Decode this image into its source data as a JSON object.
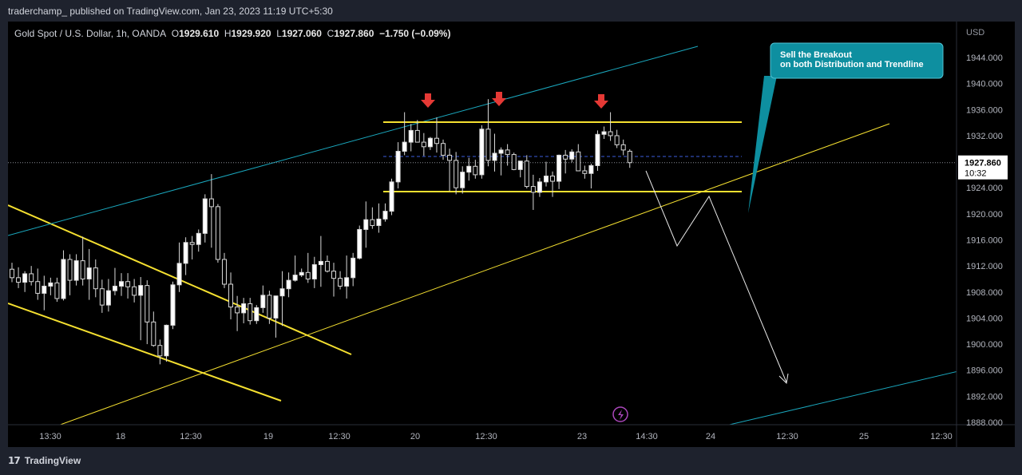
{
  "header": {
    "publisher": "traderchamp_ published on TradingView.com, Jan 23, 2023 11:19 UTC+5:30"
  },
  "legend": {
    "symbol": "Gold Spot / U.S. Dollar, 1h, OANDA",
    "o_label": "O",
    "o_value": "1929.610",
    "h_label": "H",
    "h_value": "1929.920",
    "l_label": "L",
    "l_value": "1927.060",
    "c_label": "C",
    "c_value": "1927.860",
    "change": "−1.750 (−0.09%)"
  },
  "chart_data": {
    "type": "candlestick",
    "currency_label": "USD",
    "ylim": [
      1887,
      1948
    ],
    "y_ticks": [
      "1944.000",
      "1940.000",
      "1936.000",
      "1932.000",
      "1928.000",
      "1924.000",
      "1920.000",
      "1916.000",
      "1912.000",
      "1908.000",
      "1904.000",
      "1900.000",
      "1896.000",
      "1892.000",
      "1888.000"
    ],
    "x_ticks": [
      "13:30",
      "18",
      "12:30",
      "19",
      "12:30",
      "20",
      "12:30",
      "23",
      "14:30",
      "24",
      "12:30",
      "25",
      "12:30"
    ],
    "last_price": {
      "value": 1927.86,
      "label": "1927.860",
      "countdown": "10:32"
    },
    "candles": [
      [
        1911.5,
        1912.5,
        1909.5,
        1910.2
      ],
      [
        1910.2,
        1911.8,
        1908.6,
        1909.5
      ],
      [
        1909.5,
        1911.2,
        1908.0,
        1910.8
      ],
      [
        1910.8,
        1912.0,
        1909.0,
        1909.6
      ],
      [
        1909.6,
        1911.6,
        1906.8,
        1907.8
      ],
      [
        1907.8,
        1910.5,
        1905.2,
        1908.9
      ],
      [
        1908.9,
        1910.2,
        1907.5,
        1909.4
      ],
      [
        1909.4,
        1910.2,
        1906.5,
        1907.0
      ],
      [
        1907.0,
        1914.4,
        1906.7,
        1913.0
      ],
      [
        1913.0,
        1913.8,
        1907.5,
        1909.8
      ],
      [
        1909.8,
        1913.8,
        1909.0,
        1912.8
      ],
      [
        1912.8,
        1916.5,
        1909.0,
        1910.0
      ],
      [
        1910.0,
        1914.6,
        1906.8,
        1911.7
      ],
      [
        1911.7,
        1913.0,
        1907.2,
        1908.5
      ],
      [
        1908.5,
        1909.9,
        1904.8,
        1906.0
      ],
      [
        1906.0,
        1910.0,
        1905.0,
        1908.2
      ],
      [
        1908.2,
        1911.7,
        1907.5,
        1908.9
      ],
      [
        1908.9,
        1910.9,
        1907.4,
        1909.6
      ],
      [
        1909.6,
        1910.9,
        1907.0,
        1908.8
      ],
      [
        1908.8,
        1910.0,
        1906.4,
        1907.5
      ],
      [
        1907.5,
        1910.3,
        1900.6,
        1909.0
      ],
      [
        1909.0,
        1909.8,
        1900.0,
        1903.4
      ],
      [
        1903.4,
        1905.0,
        1899.6,
        1899.8
      ],
      [
        1899.8,
        1900.7,
        1896.9,
        1898.2
      ],
      [
        1898.2,
        1903.0,
        1897.3,
        1902.9
      ],
      [
        1902.9,
        1909.6,
        1902.3,
        1909.1
      ],
      [
        1909.1,
        1915.6,
        1908.0,
        1912.4
      ],
      [
        1912.4,
        1916.4,
        1910.6,
        1915.6
      ],
      [
        1915.6,
        1916.6,
        1913.0,
        1915.3
      ],
      [
        1915.3,
        1917.6,
        1914.2,
        1917.0
      ],
      [
        1917.0,
        1923.0,
        1915.6,
        1922.3
      ],
      [
        1922.3,
        1926.1,
        1914.8,
        1921.1
      ],
      [
        1921.1,
        1921.5,
        1912.5,
        1913.0
      ],
      [
        1913.0,
        1914.0,
        1908.6,
        1909.2
      ],
      [
        1909.2,
        1911.0,
        1903.8,
        1905.7
      ],
      [
        1905.7,
        1907.4,
        1902.0,
        1904.8
      ],
      [
        1904.8,
        1907.1,
        1903.2,
        1906.2
      ],
      [
        1906.2,
        1907.1,
        1903.0,
        1903.6
      ],
      [
        1903.6,
        1906.0,
        1903.1,
        1905.6
      ],
      [
        1905.6,
        1909.0,
        1904.8,
        1907.5
      ],
      [
        1907.5,
        1908.2,
        1903.1,
        1904.0
      ],
      [
        1904.0,
        1907.0,
        1901.0,
        1907.4
      ],
      [
        1907.4,
        1911.2,
        1902.8,
        1908.5
      ],
      [
        1908.5,
        1911.0,
        1907.2,
        1909.8
      ],
      [
        1909.8,
        1913.6,
        1909.6,
        1910.6
      ],
      [
        1910.6,
        1911.6,
        1910.3,
        1911.0
      ],
      [
        1911.0,
        1914.0,
        1909.4,
        1910.0
      ],
      [
        1910.0,
        1913.4,
        1908.6,
        1912.2
      ],
      [
        1912.2,
        1916.6,
        1908.8,
        1912.7
      ],
      [
        1912.7,
        1913.6,
        1911.0,
        1911.2
      ],
      [
        1911.2,
        1912.5,
        1907.3,
        1910.1
      ],
      [
        1910.1,
        1911.2,
        1908.4,
        1908.9
      ],
      [
        1908.9,
        1913.6,
        1907.0,
        1910.2
      ],
      [
        1910.2,
        1914.0,
        1908.9,
        1913.2
      ],
      [
        1913.2,
        1918.2,
        1913.0,
        1917.6
      ],
      [
        1917.6,
        1921.9,
        1914.8,
        1919.1
      ],
      [
        1919.1,
        1921.0,
        1917.7,
        1918.2
      ],
      [
        1918.2,
        1921.6,
        1917.1,
        1919.2
      ],
      [
        1919.2,
        1921.6,
        1918.8,
        1920.4
      ],
      [
        1920.4,
        1925.4,
        1919.8,
        1924.9
      ],
      [
        1924.9,
        1931.0,
        1923.9,
        1929.6
      ],
      [
        1929.6,
        1935.6,
        1929.0,
        1931.0
      ],
      [
        1931.0,
        1933.8,
        1929.6,
        1932.8
      ],
      [
        1932.8,
        1934.4,
        1931.6,
        1931.0
      ],
      [
        1931.0,
        1932.4,
        1928.9,
        1930.3
      ],
      [
        1930.3,
        1931.8,
        1929.8,
        1931.6
      ],
      [
        1931.6,
        1934.8,
        1929.4,
        1930.8
      ],
      [
        1930.8,
        1931.4,
        1928.3,
        1929.0
      ],
      [
        1929.0,
        1930.0,
        1923.5,
        1928.2
      ],
      [
        1928.2,
        1929.5,
        1923.0,
        1924.0
      ],
      [
        1924.0,
        1927.3,
        1923.1,
        1926.4
      ],
      [
        1926.4,
        1928.6,
        1925.1,
        1927.3
      ],
      [
        1927.3,
        1928.3,
        1925.4,
        1926.0
      ],
      [
        1926.0,
        1933.6,
        1925.4,
        1933.0
      ],
      [
        1933.0,
        1937.6,
        1927.3,
        1928.2
      ],
      [
        1928.2,
        1932.3,
        1926.5,
        1929.3
      ],
      [
        1929.3,
        1930.2,
        1925.9,
        1929.8
      ],
      [
        1929.8,
        1930.7,
        1927.4,
        1929.1
      ],
      [
        1929.1,
        1929.4,
        1926.7,
        1926.8
      ],
      [
        1926.8,
        1928.1,
        1925.6,
        1928.1
      ],
      [
        1928.1,
        1929.0,
        1923.9,
        1924.2
      ],
      [
        1924.2,
        1926.0,
        1920.6,
        1923.3
      ],
      [
        1923.3,
        1925.5,
        1922.6,
        1924.9
      ],
      [
        1924.9,
        1928.0,
        1924.2,
        1925.8
      ],
      [
        1925.8,
        1926.5,
        1922.6,
        1925.0
      ],
      [
        1925.0,
        1929.1,
        1923.8,
        1929.0
      ],
      [
        1929.0,
        1929.8,
        1926.2,
        1928.4
      ],
      [
        1928.4,
        1929.9,
        1927.9,
        1929.5
      ],
      [
        1929.5,
        1930.7,
        1926.6,
        1926.6
      ],
      [
        1926.6,
        1927.4,
        1925.4,
        1926.2
      ],
      [
        1926.2,
        1927.7,
        1923.9,
        1927.4
      ],
      [
        1927.4,
        1932.8,
        1926.6,
        1932.2
      ],
      [
        1932.2,
        1933.4,
        1931.5,
        1932.6
      ],
      [
        1932.6,
        1935.6,
        1931.2,
        1932.0
      ],
      [
        1932.0,
        1932.9,
        1930.1,
        1930.6
      ],
      [
        1930.6,
        1931.4,
        1929.0,
        1929.8
      ],
      [
        1929.61,
        1929.92,
        1927.06,
        1927.86
      ]
    ],
    "annotations": {
      "callout_text_line1": "Sell the Breakout",
      "callout_text_line2": "on both Distribution and Trendline"
    }
  },
  "footer": {
    "brand": "TradingView"
  },
  "colors": {
    "background": "#000000",
    "frame": "#1e222d",
    "yellow": "#f5e030",
    "cyan": "#1aa7bd",
    "callout": "#0e8fa0",
    "arrow_red": "#e53935",
    "dashed_blue": "#3b5bdb"
  }
}
